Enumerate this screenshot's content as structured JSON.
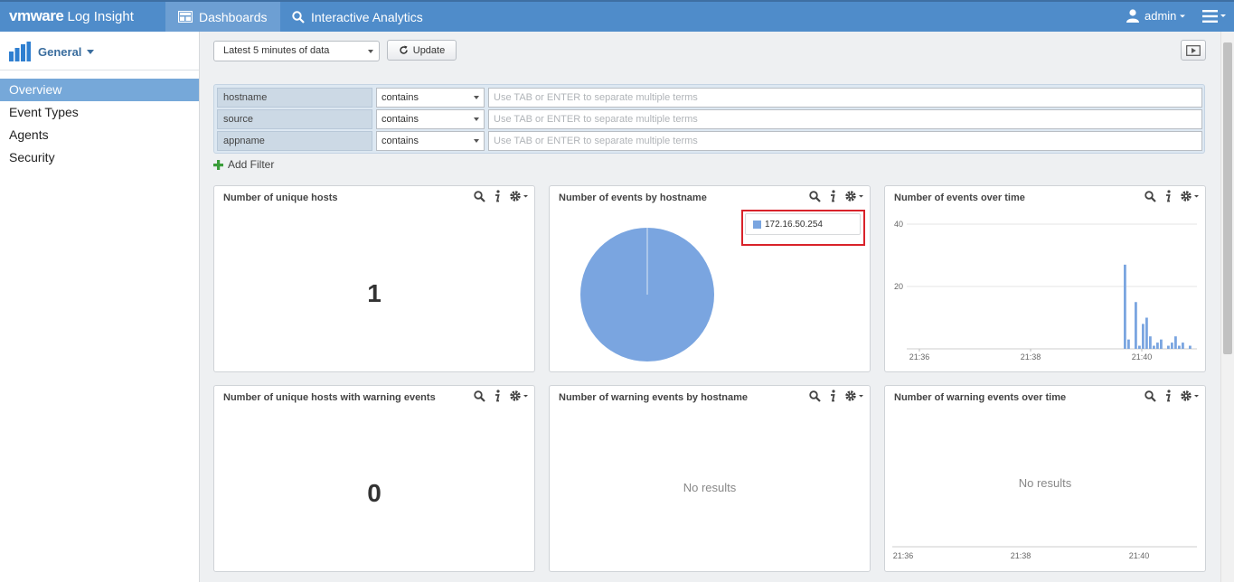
{
  "app": {
    "brand_vm": "vmware",
    "brand_name": " Log Insight"
  },
  "nav": {
    "tabs": [
      {
        "label": "Dashboards",
        "icon": "dashboard-icon",
        "active": true
      },
      {
        "label": "Interactive Analytics",
        "icon": "search-icon",
        "active": false
      }
    ],
    "user": "admin"
  },
  "sidebar": {
    "dashboard_group": "General",
    "items": [
      {
        "label": "Overview",
        "active": true
      },
      {
        "label": "Event Types",
        "active": false
      },
      {
        "label": "Agents",
        "active": false
      },
      {
        "label": "Security",
        "active": false
      }
    ]
  },
  "toolbar": {
    "time_range": "Latest 5 minutes of data",
    "update_label": "Update"
  },
  "filters": {
    "rows": [
      {
        "field": "hostname",
        "operator": "contains",
        "placeholder": "Use TAB or ENTER to separate multiple terms"
      },
      {
        "field": "source",
        "operator": "contains",
        "placeholder": "Use TAB or ENTER to separate multiple terms"
      },
      {
        "field": "appname",
        "operator": "contains",
        "placeholder": "Use TAB or ENTER to separate multiple terms"
      }
    ],
    "add_label": "Add Filter"
  },
  "widgets": {
    "unique_hosts": {
      "title": "Number of unique hosts",
      "value": "1"
    },
    "events_by_hostname": {
      "title": "Number of events by hostname",
      "legend": "172.16.50.254"
    },
    "events_over_time": {
      "title": "Number of events over time"
    },
    "warning_hosts": {
      "title": "Number of unique hosts with warning events",
      "value": "0"
    },
    "warning_by_hostname": {
      "title": "Number of warning events by hostname",
      "empty": "No results"
    },
    "warning_over_time": {
      "title": "Number of warning events over time",
      "empty": "No results"
    }
  },
  "colors": {
    "topbar": "#4f8cca",
    "series": "#7aa5e0",
    "highlight": "#d9222a"
  },
  "chart_data": [
    {
      "type": "pie",
      "categories": [
        "172.16.50.254"
      ],
      "values": [
        100
      ]
    },
    {
      "type": "bar",
      "xlabel": "",
      "ylabel": "",
      "ylim": [
        0,
        40
      ],
      "y_ticks": [
        "20",
        "40"
      ],
      "x_ticks": [
        "21:36",
        "21:38",
        "21:40"
      ],
      "grid": true,
      "values": [
        0,
        0,
        0,
        0,
        0,
        0,
        0,
        0,
        0,
        0,
        0,
        0,
        0,
        0,
        0,
        0,
        0,
        0,
        0,
        0,
        0,
        0,
        0,
        0,
        0,
        0,
        0,
        0,
        0,
        0,
        0,
        0,
        0,
        0,
        0,
        0,
        0,
        0,
        0,
        0,
        0,
        0,
        0,
        0,
        0,
        0,
        0,
        0,
        0,
        0,
        0,
        0,
        0,
        0,
        0,
        0,
        0,
        0,
        0,
        0,
        27,
        3,
        0,
        15,
        1,
        8,
        10,
        4,
        1,
        2,
        3,
        0,
        1,
        2,
        4,
        1,
        2,
        0,
        1
      ]
    },
    {
      "type": "bar",
      "x_ticks": [
        "21:36",
        "21:38",
        "21:40"
      ],
      "values": []
    }
  ]
}
